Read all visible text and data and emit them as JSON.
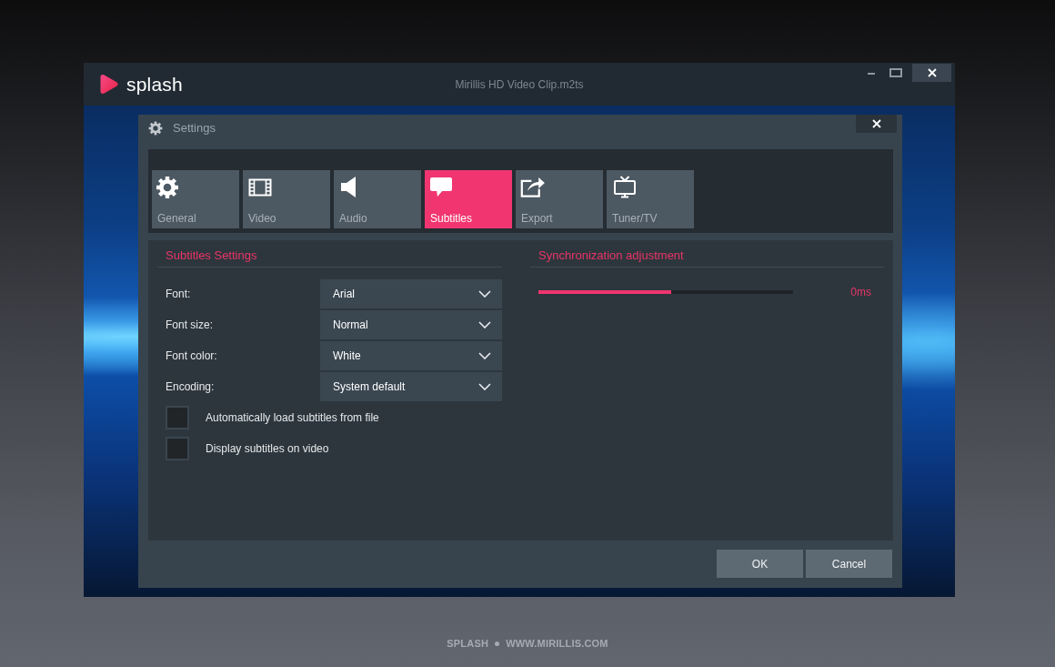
{
  "window": {
    "app_name": "splash",
    "title": "Mirillis HD Video Clip.m2ts"
  },
  "dialog": {
    "title": "Settings",
    "tabs": [
      {
        "label": "General",
        "selected": false
      },
      {
        "label": "Video",
        "selected": false
      },
      {
        "label": "Audio",
        "selected": false
      },
      {
        "label": "Subtitles",
        "selected": true
      },
      {
        "label": "Export",
        "selected": false
      },
      {
        "label": "Tuner/TV",
        "selected": false
      }
    ],
    "subtitles_settings": {
      "heading": "Subtitles Settings",
      "fields": [
        {
          "label": "Font:",
          "value": "Arial"
        },
        {
          "label": "Font size:",
          "value": "Normal"
        },
        {
          "label": "Font color:",
          "value": "White"
        },
        {
          "label": "Encoding:",
          "value": "System default"
        }
      ],
      "checkboxes": [
        {
          "label": "Automatically load subtitles from file",
          "checked": false
        },
        {
          "label": "Display subtitles on video",
          "checked": false
        }
      ]
    },
    "synchronization": {
      "heading": "Synchronization adjustment",
      "level": 0.52,
      "reading": "0ms"
    },
    "buttons": [
      "OK",
      "Cancel"
    ]
  },
  "footer": {
    "brand": "SPLASH",
    "url": "WWW.MIRILLIS.COM"
  }
}
